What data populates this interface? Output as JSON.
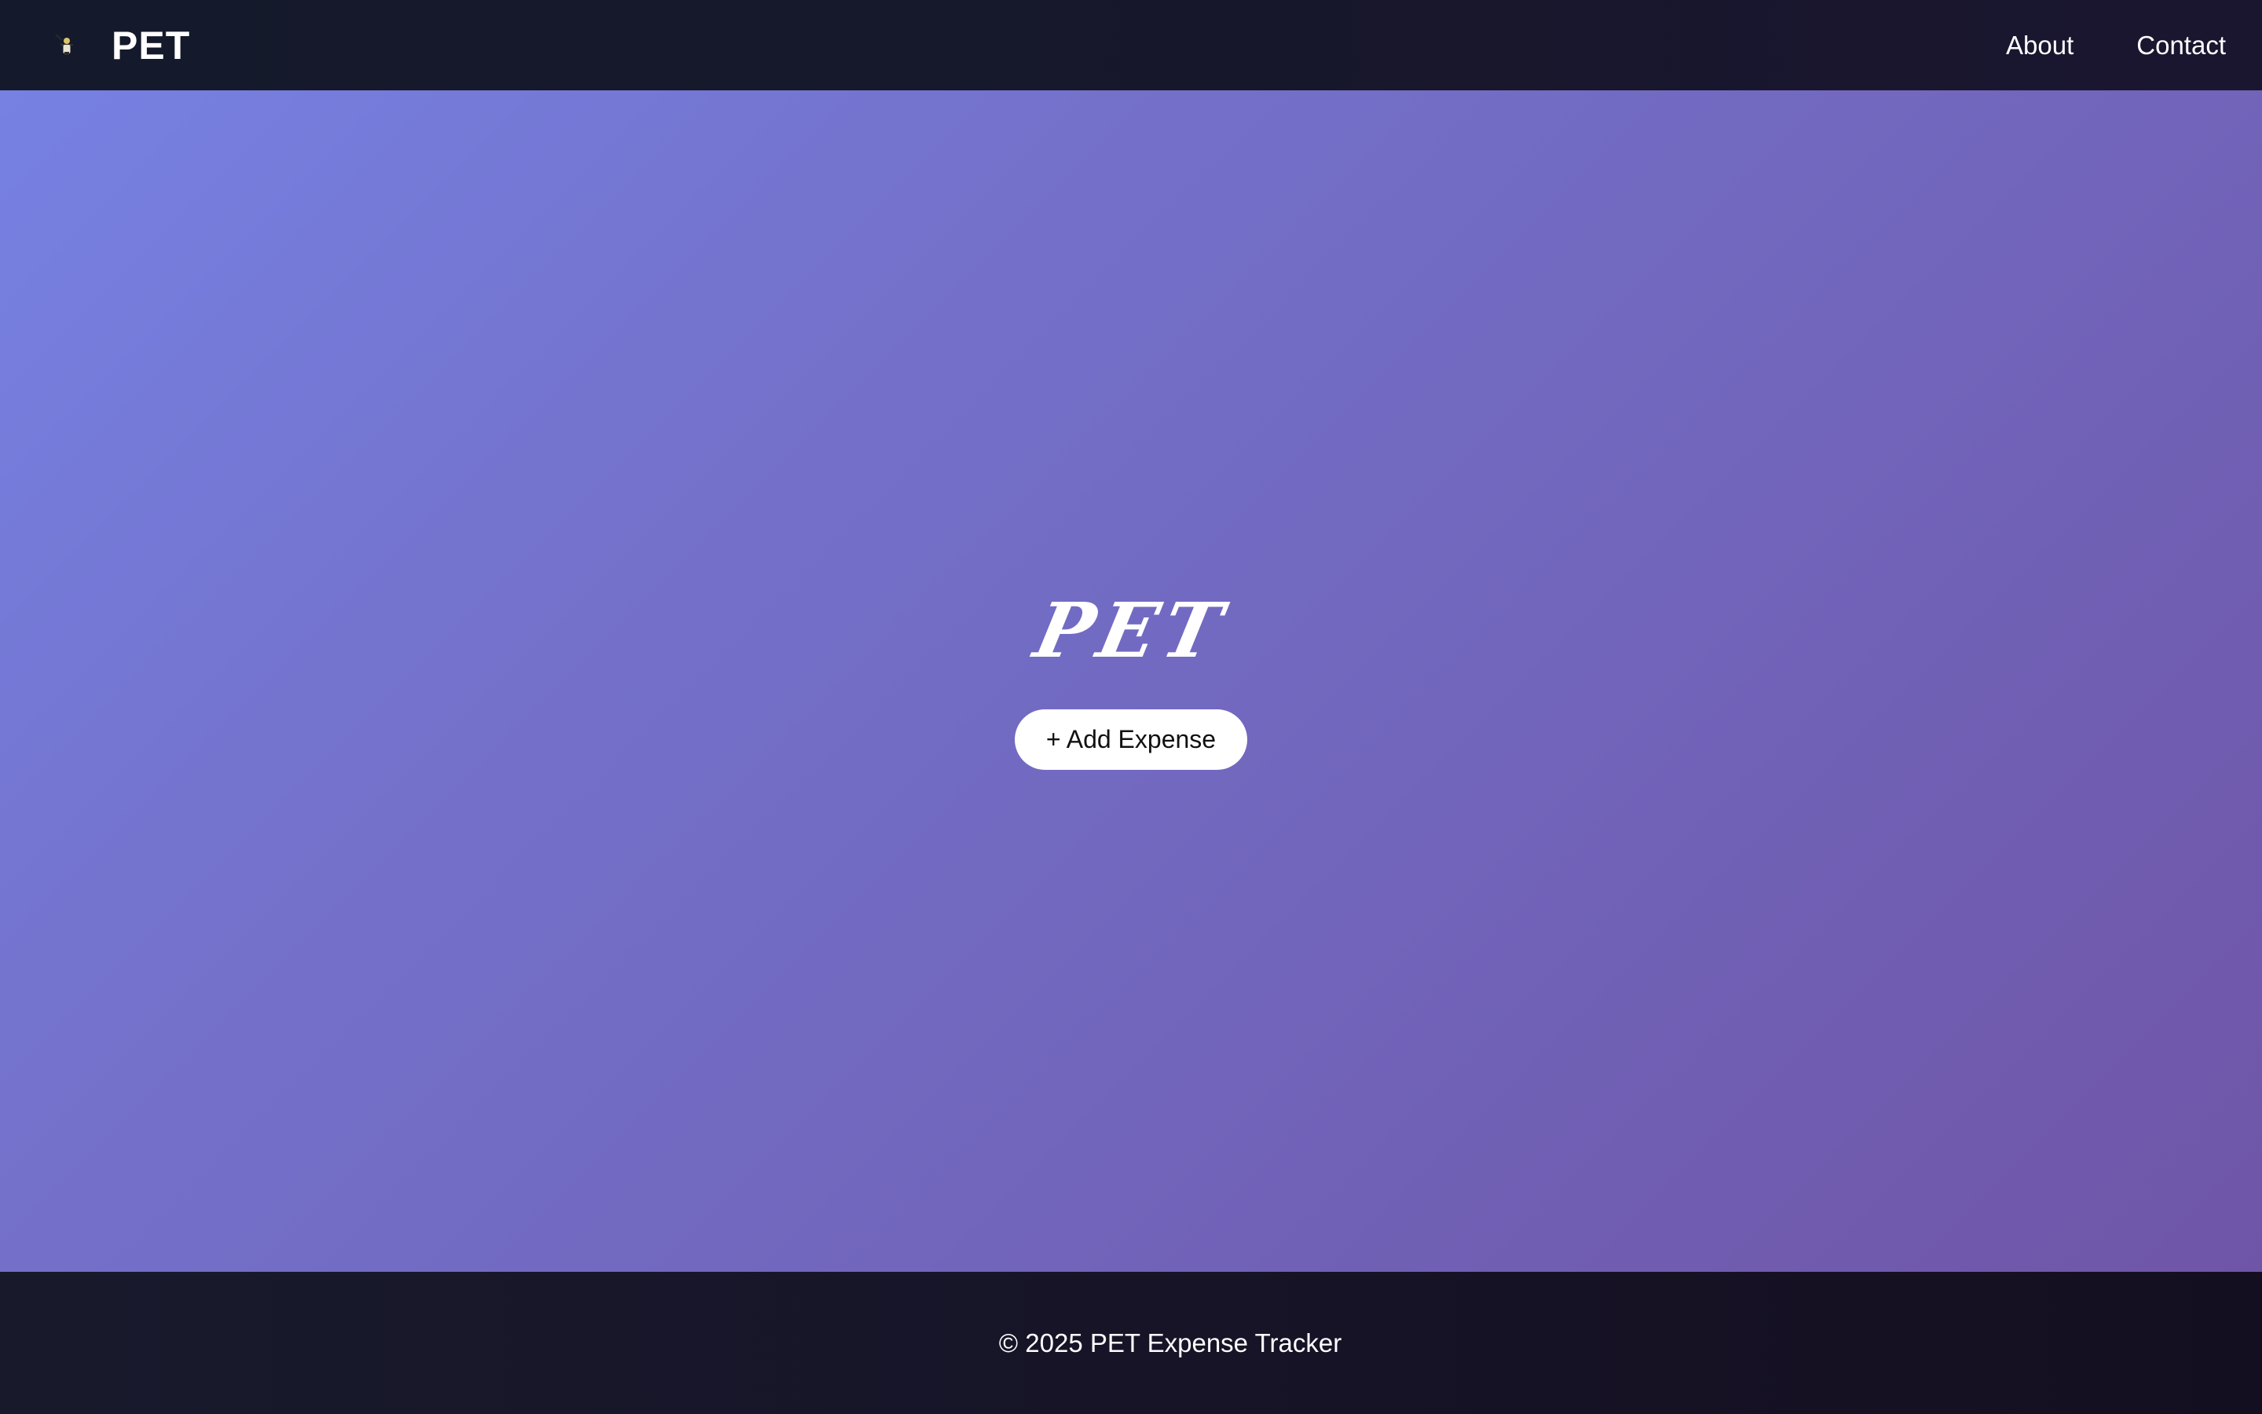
{
  "navbar": {
    "brand_name": "PET",
    "logo_icon": "mascot-icon",
    "links": [
      {
        "label": "About"
      },
      {
        "label": "Contact"
      }
    ]
  },
  "hero": {
    "title": "PET",
    "add_button_label": "+ Add Expense"
  },
  "footer": {
    "text": "© 2025 PET Expense Tracker"
  },
  "colors": {
    "navbar_bg": "#161a2b",
    "hero_gradient_start": "#7681e2",
    "hero_gradient_end": "#6f55a7",
    "footer_bg": "#171428",
    "button_bg": "#ffffff"
  }
}
